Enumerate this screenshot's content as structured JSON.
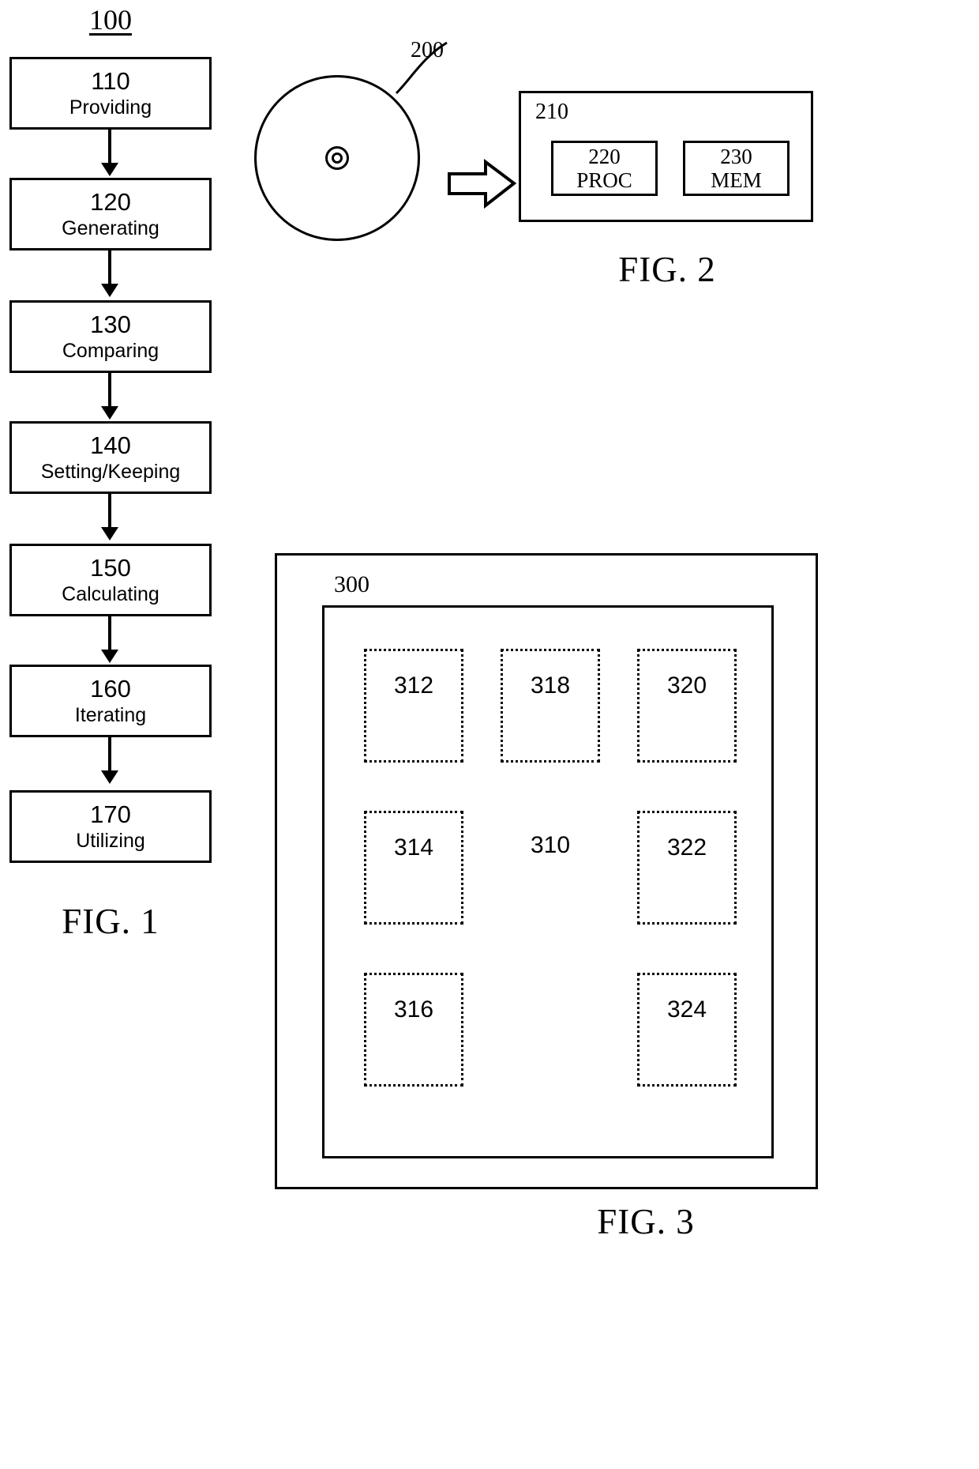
{
  "figures": {
    "fig1": {
      "caption": "FIG. 1",
      "reference_numeral": "100",
      "steps": [
        {
          "number": "110",
          "label": "Providing"
        },
        {
          "number": "120",
          "label": "Generating"
        },
        {
          "number": "130",
          "label": "Comparing"
        },
        {
          "number": "140",
          "label": "Setting/Keeping"
        },
        {
          "number": "150",
          "label": "Calculating"
        },
        {
          "number": "160",
          "label": "Iterating"
        },
        {
          "number": "170",
          "label": "Utilizing"
        }
      ]
    },
    "fig2": {
      "caption": "FIG. 2",
      "disc_reference_numeral": "200",
      "system_reference_numeral": "210",
      "blocks": [
        {
          "number": "220",
          "name": "PROC"
        },
        {
          "number": "230",
          "name": "MEM"
        }
      ]
    },
    "fig3": {
      "caption": "FIG. 3",
      "outer_reference_numeral": "300",
      "center_reference_numeral": "310",
      "cells": [
        {
          "number": "312",
          "row": 0,
          "col": 0,
          "dotted": true
        },
        {
          "number": "318",
          "row": 0,
          "col": 1,
          "dotted": true
        },
        {
          "number": "320",
          "row": 0,
          "col": 2,
          "dotted": true
        },
        {
          "number": "314",
          "row": 1,
          "col": 0,
          "dotted": true
        },
        {
          "number": "310",
          "row": 1,
          "col": 1,
          "dotted": false
        },
        {
          "number": "322",
          "row": 1,
          "col": 2,
          "dotted": true
        },
        {
          "number": "316",
          "row": 2,
          "col": 0,
          "dotted": true
        },
        {
          "number": "324",
          "row": 2,
          "col": 2,
          "dotted": true
        }
      ]
    }
  },
  "colors": {
    "line": "#000000",
    "background": "#ffffff"
  }
}
